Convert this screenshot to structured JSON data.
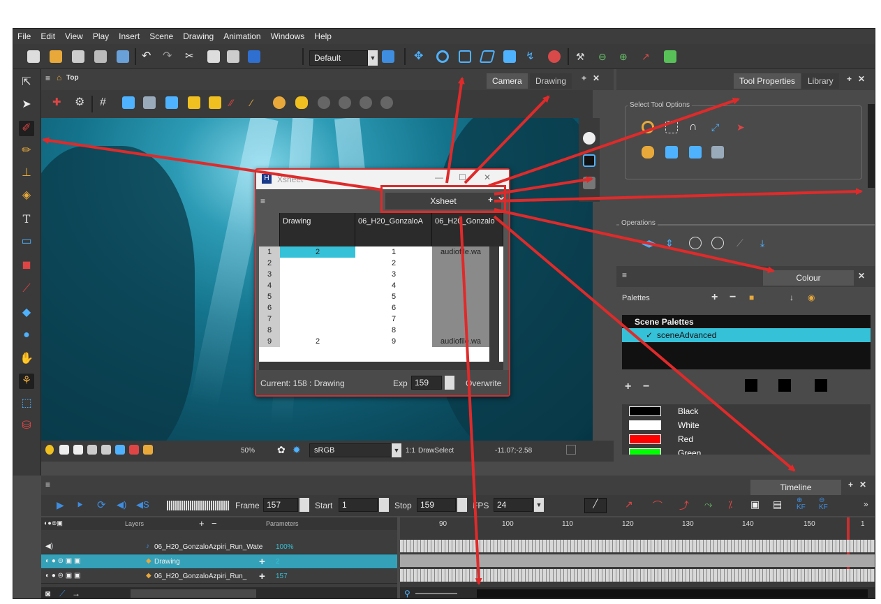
{
  "menu": [
    "File",
    "Edit",
    "View",
    "Play",
    "Insert",
    "Scene",
    "Drawing",
    "Animation",
    "Windows",
    "Help"
  ],
  "toolbar": {
    "workspace_value": "Default"
  },
  "camera_view": {
    "title": "Top",
    "tabs": [
      "Camera",
      "Drawing"
    ],
    "status": {
      "zoom": "50%",
      "colour_space": "sRGB",
      "ratio": "1:1",
      "tool": "DrawSelect",
      "coords": "-11.07;-2.58"
    }
  },
  "xsheet": {
    "window_title": "Xsheet",
    "tab_label": "Xsheet",
    "columns": [
      "Drawing",
      "06_H20_GonzaloA",
      "06_H20_Gonzalo"
    ],
    "rows": [
      {
        "n": "1",
        "drawing": "2",
        "col2": "1",
        "col3": "audiofile.wa"
      },
      {
        "n": "2",
        "drawing": "",
        "col2": "2",
        "col3": ""
      },
      {
        "n": "3",
        "drawing": "",
        "col2": "3",
        "col3": ""
      },
      {
        "n": "4",
        "drawing": "",
        "col2": "4",
        "col3": ""
      },
      {
        "n": "5",
        "drawing": "",
        "col2": "5",
        "col3": ""
      },
      {
        "n": "6",
        "drawing": "",
        "col2": "6",
        "col3": ""
      },
      {
        "n": "7",
        "drawing": "",
        "col2": "7",
        "col3": ""
      },
      {
        "n": "8",
        "drawing": "",
        "col2": "8",
        "col3": ""
      },
      {
        "n": "9",
        "drawing": "2",
        "col2": "9",
        "col3": "audiofile.wa"
      }
    ],
    "current": "Current: 158 : Drawing",
    "exp_label": "Exp",
    "exp_value": "159",
    "mode": "Overwrite"
  },
  "tool_properties": {
    "tabs": [
      "Tool Properties",
      "Library"
    ],
    "section_select": "Select Tool Options",
    "section_operations": "Operations"
  },
  "colour": {
    "tab": "Colour",
    "palettes_label": "Palettes",
    "scene_palettes": "Scene Palettes",
    "palette_item": "sceneAdvanced",
    "swatches": [
      {
        "name": "Black",
        "color": "#000000"
      },
      {
        "name": "White",
        "color": "#ffffff"
      },
      {
        "name": "Red",
        "color": "#ff0000"
      },
      {
        "name": "Green",
        "color": "#00ff00"
      }
    ]
  },
  "timeline": {
    "tab": "Timeline",
    "frame_label": "Frame",
    "frame_value": "157",
    "start_label": "Start",
    "start_value": "1",
    "stop_label": "Stop",
    "stop_value": "159",
    "fps_label": "FPS",
    "fps_value": "24",
    "layers_header": "Layers",
    "params_header": "Parameters",
    "ruler": [
      "90",
      "100",
      "110",
      "120",
      "130",
      "140",
      "150",
      "1"
    ],
    "layers": [
      {
        "name": "06_H20_GonzaloAzpiri_Run_Wate",
        "param": "100%"
      },
      {
        "name": "Drawing",
        "param": "2"
      },
      {
        "name": "06_H20_GonzaloAzpiri_Run_",
        "param": "157"
      }
    ]
  },
  "colors": {
    "annotation_red": "#e02a2a",
    "selection_blue": "#35c1d8"
  }
}
